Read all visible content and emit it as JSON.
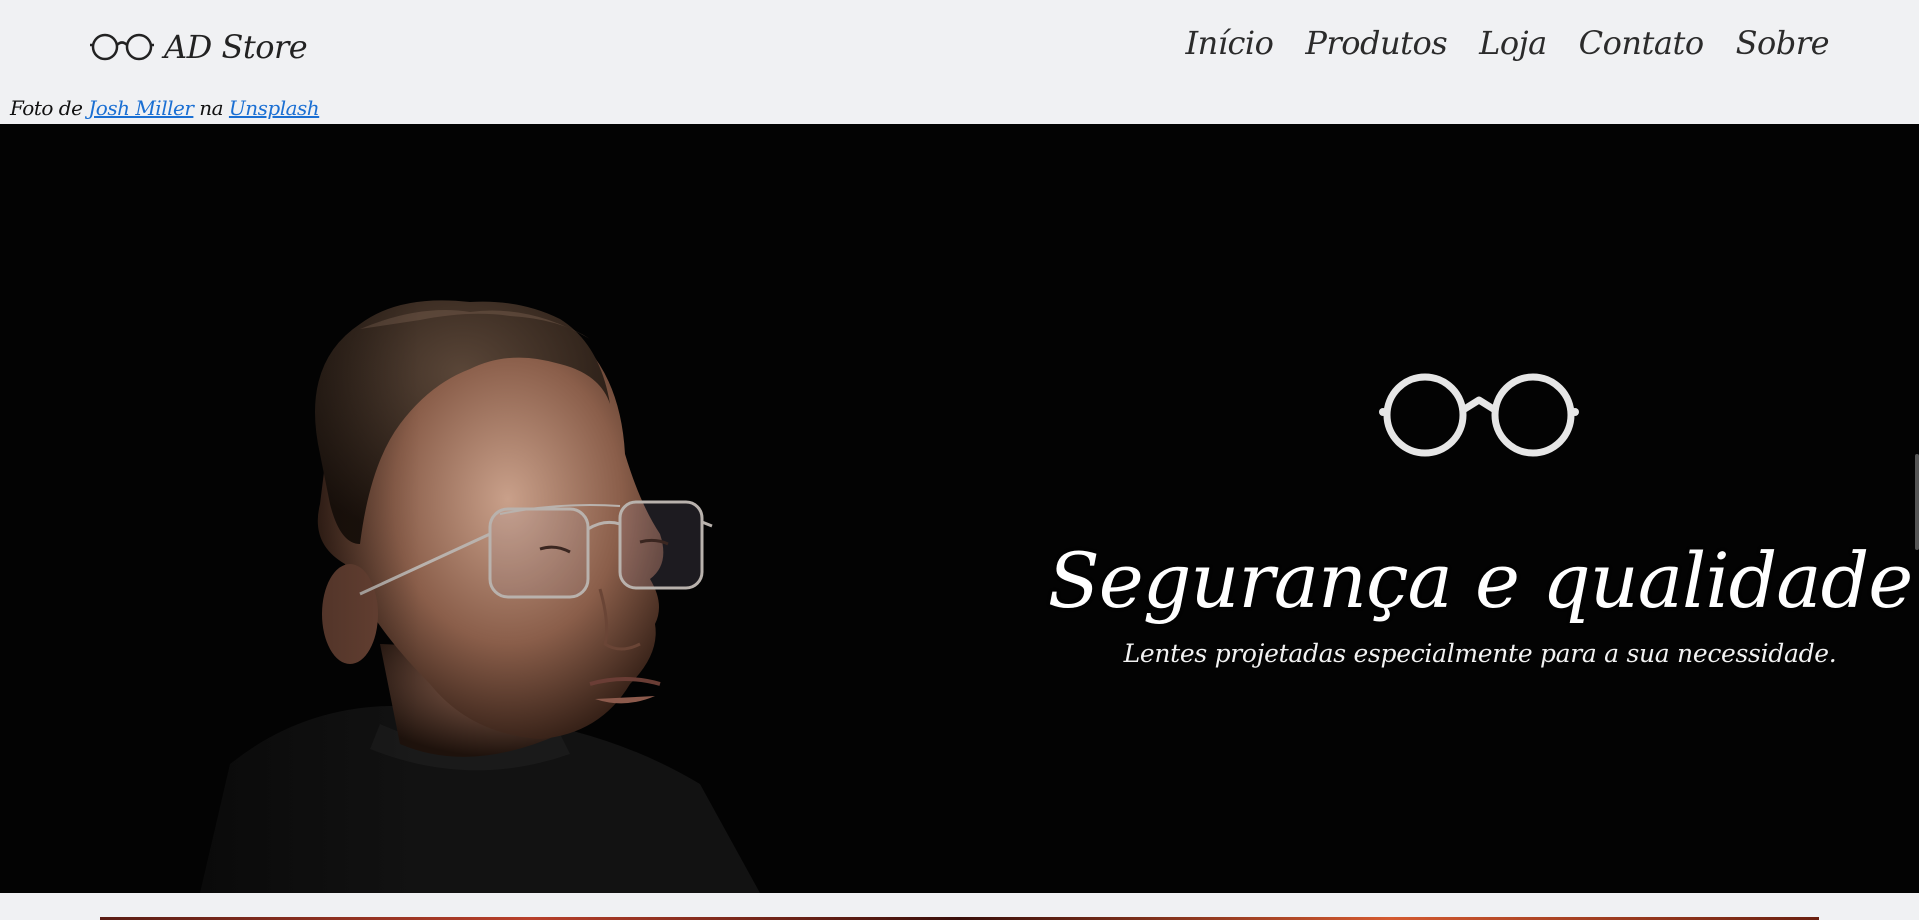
{
  "header": {
    "brand_name": "AD Store",
    "brand_icon": "glasses-icon",
    "nav": [
      {
        "label": "Início"
      },
      {
        "label": "Produtos"
      },
      {
        "label": "Loja"
      },
      {
        "label": "Contato"
      },
      {
        "label": "Sobre"
      }
    ]
  },
  "credit": {
    "prefix": "Foto de",
    "author": "Josh Miller",
    "middle": "na",
    "site": "Unsplash"
  },
  "hero": {
    "icon": "glasses-icon",
    "title": "Segurança e qualidade",
    "subtitle": "Lentes projetadas especialmente para a sua necessidade."
  },
  "colors": {
    "header_bg": "#f0f1f3",
    "hero_bg": "#030303",
    "link": "#1a6fd3",
    "hero_text": "#ffffff"
  }
}
